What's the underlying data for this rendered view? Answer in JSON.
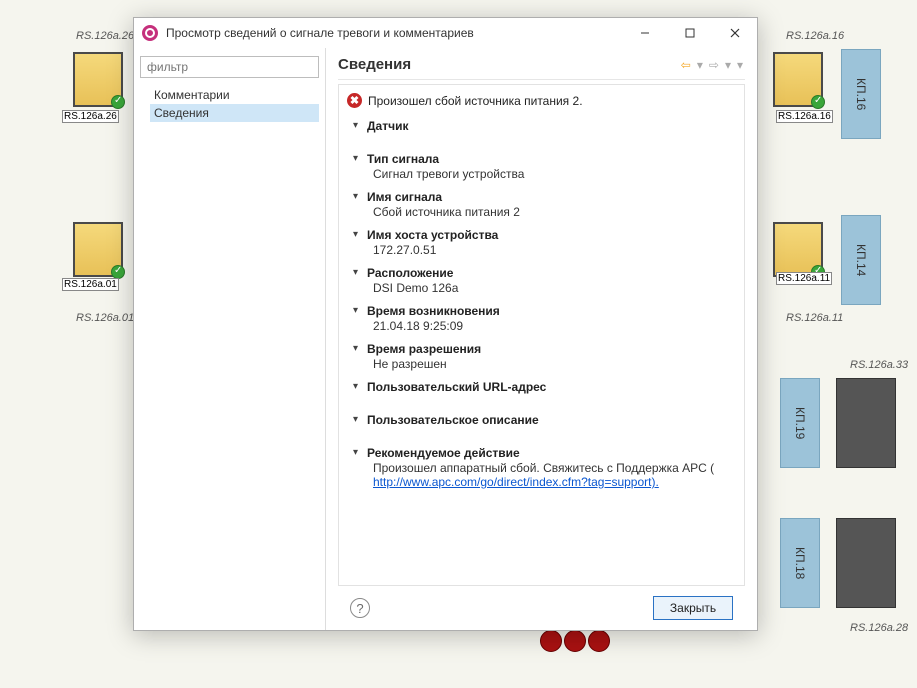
{
  "window": {
    "title": "Просмотр сведений о сигнале тревоги и комментариев"
  },
  "sidebar": {
    "filter_placeholder": "фильтр",
    "items": [
      {
        "label": "Комментарии"
      },
      {
        "label": "Сведения"
      }
    ]
  },
  "header": {
    "title": "Сведения"
  },
  "alert": {
    "message": "Произошел сбой источника питания 2."
  },
  "sections": {
    "sensor": {
      "label": "Датчик"
    },
    "signal_type": {
      "label": "Тип сигнала",
      "value": "Сигнал тревоги устройства"
    },
    "signal_name": {
      "label": "Имя сигнала",
      "value": "Сбой источника питания 2"
    },
    "hostname": {
      "label": "Имя хоста устройства",
      "value": "172.27.0.51"
    },
    "location": {
      "label": "Расположение",
      "value": "DSI Demo 126a"
    },
    "time_occurred": {
      "label": "Время возникновения",
      "value": "21.04.18 9:25:09"
    },
    "time_resolved": {
      "label": "Время разрешения",
      "value": "Не разрешен"
    },
    "user_url": {
      "label": "Пользовательский URL-адрес"
    },
    "user_desc": {
      "label": "Пользовательское описание"
    },
    "recommended": {
      "label": "Рекомендуемое действие",
      "text_before": "Произошел аппаратный сбой. Свяжитесь с Поддержка APC ( ",
      "link": "http://www.apc.com/go/direct/index.cfm?tag=support).",
      "link_href": "http://www.apc.com/go/direct/index.cfm?tag=support"
    }
  },
  "footer": {
    "close": "Закрыть"
  },
  "background": {
    "labels": {
      "a26_top": "RS.126a.26",
      "a26": "RS.126a.26",
      "a01": "RS.126a.01",
      "a01_bot": "RS.126a.01",
      "a16_top": "RS.126a.16",
      "a16": "RS.126a.16",
      "a11": "RS.126a.11",
      "a11_bot": "RS.126a.11",
      "a33": "RS.126a.33",
      "a28": "RS.126a.28"
    },
    "kp": {
      "k16": "КП.16",
      "k14": "КП.14",
      "k19": "КП.19",
      "k18": "КП.18"
    }
  }
}
